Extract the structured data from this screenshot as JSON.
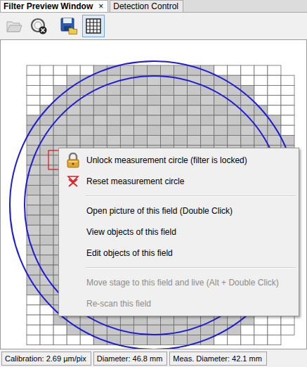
{
  "window": {
    "title": "Filter Preview Window"
  },
  "tabs": [
    {
      "label": "Filter Preview Window",
      "close": "×",
      "selected": true
    },
    {
      "label": "Detection Control",
      "close": "",
      "selected": false
    }
  ],
  "toolbar": [
    {
      "kind": "open",
      "disabled": true,
      "selected": false
    },
    {
      "kind": "clear",
      "disabled": false,
      "selected": false
    },
    {
      "kind": "save",
      "disabled": false,
      "selected": false
    },
    {
      "kind": "grid",
      "disabled": false,
      "selected": true
    }
  ],
  "filter_view": {
    "locked": true,
    "field_marked": true
  },
  "context_menu": {
    "items": [
      {
        "kind": "lock",
        "label": "Unlock measurement circle (filter is locked)",
        "disabled": false
      },
      {
        "kind": "reset",
        "label": "Reset measurement circle",
        "disabled": false
      },
      {
        "kind": "separator",
        "label": "",
        "disabled": false
      },
      {
        "kind": "plain",
        "label": "Open picture of this field (Double Click)",
        "disabled": false
      },
      {
        "kind": "plain",
        "label": "View objects of this field",
        "disabled": false
      },
      {
        "kind": "plain",
        "label": "Edit objects of this field",
        "disabled": false
      },
      {
        "kind": "separator",
        "label": "",
        "disabled": false
      },
      {
        "kind": "plain",
        "label": "Move stage to this field and live (Alt + Double Click)",
        "disabled": true
      },
      {
        "kind": "plain",
        "label": "Re-scan this field",
        "disabled": true
      }
    ]
  },
  "status_bar": [
    {
      "text": "Calibration: 2.69 µm/pix"
    },
    {
      "text": "Diameter: 46.8 mm"
    },
    {
      "text": "Meas. Diameter: 42.1 mm"
    }
  ]
}
